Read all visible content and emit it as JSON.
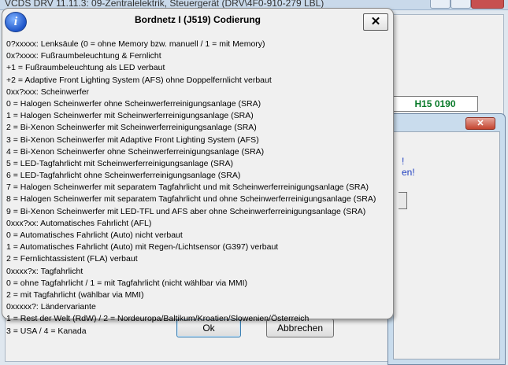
{
  "background_window": {
    "title": "VCDS DRV 11.11.3: 09-Zentralelektrik,  Steuergerät (DRV\\4F0-910-279 LBL)",
    "code_value": "H15 0190"
  },
  "second_dialog": {
    "text_line1": "!",
    "text_line2": "en!"
  },
  "coding_dialog": {
    "ok_label": "Ok",
    "cancel_label": "Abbrechen"
  },
  "info_popup": {
    "title": "Bordnetz I (J519) Codierung",
    "icon_glyph": "i",
    "close_glyph": "✕",
    "lines": [
      "0?xxxxx: Lenksäule (0 = ohne Memory bzw. manuell / 1 = mit Memory)",
      "0x?xxxx: Fußraumbeleuchtung & Fernlicht",
      "+1 = Fußraumbeleuchtung als LED verbaut",
      "+2 = Adaptive Front Lighting System (AFS) ohne Doppelfernlicht verbaut",
      "0xx?xxx: Scheinwerfer",
      "0 = Halogen Scheinwerfer ohne Scheinwerferreinigungsanlage (SRA)",
      "1 = Halogen Scheinwerfer mit Scheinwerferreinigungsanlage (SRA)",
      "2 = Bi-Xenon Scheinwerfer mit Scheinwerferreinigungsanlage (SRA)",
      "3 = Bi-Xenon Scheinwerfer mit Adaptive Front Lighting System (AFS)",
      "4 = Bi-Xenon Scheinwerfer ohne Scheinwerferreinigungsanlage (SRA)",
      "5 = LED-Tagfahrlicht mit Scheinwerferreinigungsanlage (SRA)",
      "6 = LED-Tagfahrlicht ohne Scheinwerferreinigungsanlage (SRA)",
      "7 = Halogen Scheinwerfer mit separatem Tagfahrlicht und mit Scheinwerferreinigungsanlage (SRA)",
      "8 = Halogen Scheinwerfer mit separatem Tagfahrlicht und ohne Scheinwerferreinigungsanlage (SRA)",
      "9 = Bi-Xenon Scheinwerfer mit LED-TFL und AFS aber ohne Scheinwerferreinigungsanlage (SRA)",
      "0xxx?xx: Automatisches Fahrlicht (AFL)",
      "0 = Automatisches Fahrlicht (Auto) nicht verbaut",
      "1 = Automatisches Fahrlicht (Auto) mit Regen-/Lichtsensor (G397) verbaut",
      "2 = Fernlichtassistent (FLA) verbaut",
      "0xxxx?x: Tagfahrlicht",
      "0 = ohne Tagfahrlicht / 1 = mit Tagfahrlicht (nicht wählbar via MMI)",
      "2 = mit Tagfahrlicht (wählbar via MMI)",
      "0xxxxx?: Ländervariante",
      "1 = Rest der Welt (RdW) / 2 = Nordeuropa/Baltikum/Kroatien/Slowenien/Österreich",
      "3 = USA / 4 = Kanada"
    ]
  }
}
